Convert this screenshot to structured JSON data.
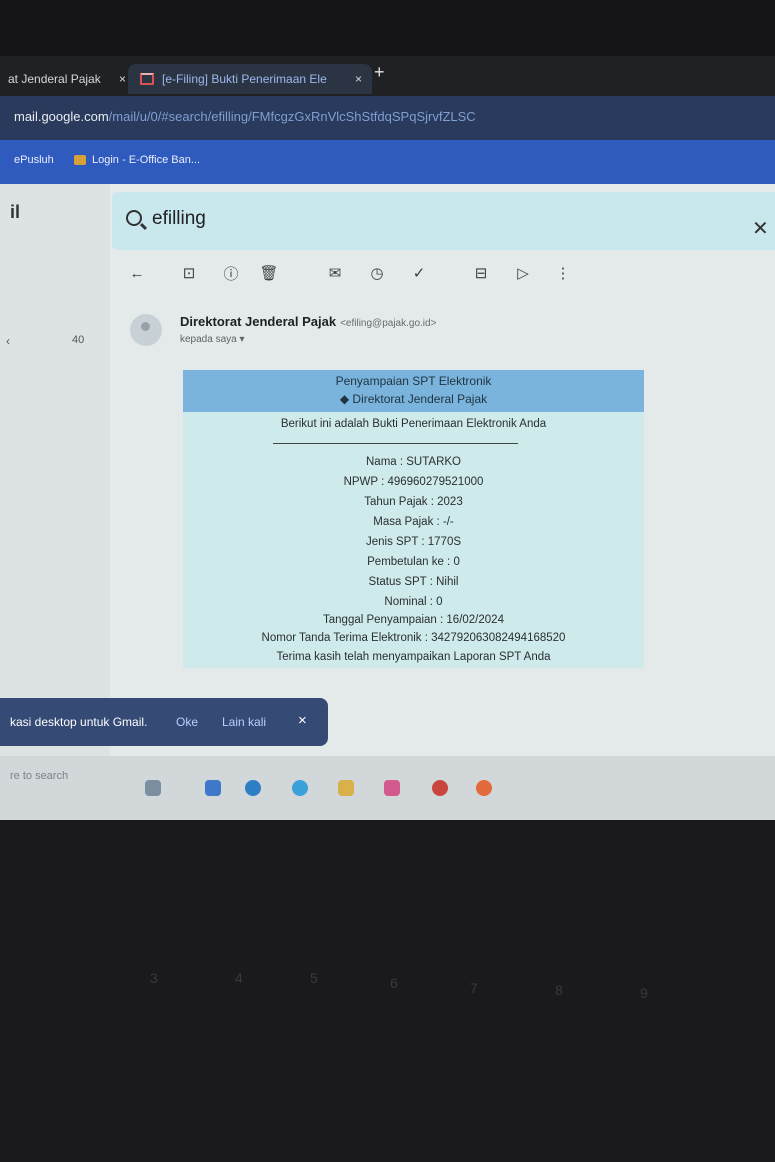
{
  "tabs": [
    {
      "label": "at Jenderal Pajak",
      "close": "×"
    },
    {
      "label": "[e-Filing] Bukti Penerimaan Ele",
      "close": "×"
    }
  ],
  "new_tab": "+",
  "url": {
    "host": "mail.google.com",
    "path": "/mail/u/0/#search/efilling/FMfcgzGxRnVlcShStfdqSPqSjrvfZLSC"
  },
  "bookmarks": [
    {
      "label": "ePusluh"
    },
    {
      "label": "Login - E-Office Ban..."
    }
  ],
  "gmail": {
    "logo_fragment": "il",
    "search_value": "efilling",
    "rail_left": "‹",
    "rail_count": "40"
  },
  "email": {
    "sender_name": "Direktorat Jenderal Pajak",
    "sender_email": "<efiling@pajak.go.id>",
    "recipient": "kepada saya ▾",
    "receipt": {
      "title1": "Penyampaian SPT Elektronik",
      "title2": "◆ Direktorat Jenderal Pajak",
      "intro": "Berikut ini adalah Bukti Penerimaan Elektronik Anda",
      "nama": "Nama : SUTARKO",
      "npwp": "NPWP : 496960279521000",
      "tahun": "Tahun Pajak : 2023",
      "masa": "Masa Pajak : -/-",
      "jenis": "Jenis SPT : 1770S",
      "pembetulan": "Pembetulan ke : 0",
      "status": "Status SPT : Nihil",
      "nominal": "Nominal : 0",
      "tanggal": "Tanggal Penyampaian : 16/02/2024",
      "ntte": "Nomor Tanda Terima Elektronik : 342792063082494168520",
      "thanks": "Terima kasih telah menyampaikan Laporan SPT Anda"
    }
  },
  "notification": {
    "message": "kasi desktop untuk Gmail.",
    "ok": "Oke",
    "later": "Lain kali",
    "close": "×"
  },
  "taskbar": {
    "search_placeholder": "re to search"
  },
  "icons": {
    "back": "arrow-left-icon",
    "archive": "archive-icon",
    "report": "report-spam-icon",
    "delete": "trash-icon",
    "unread": "mark-unread-icon",
    "snooze": "clock-icon",
    "task": "add-task-icon",
    "move": "move-to-icon",
    "label": "label-icon",
    "more": "more-vert-icon"
  }
}
